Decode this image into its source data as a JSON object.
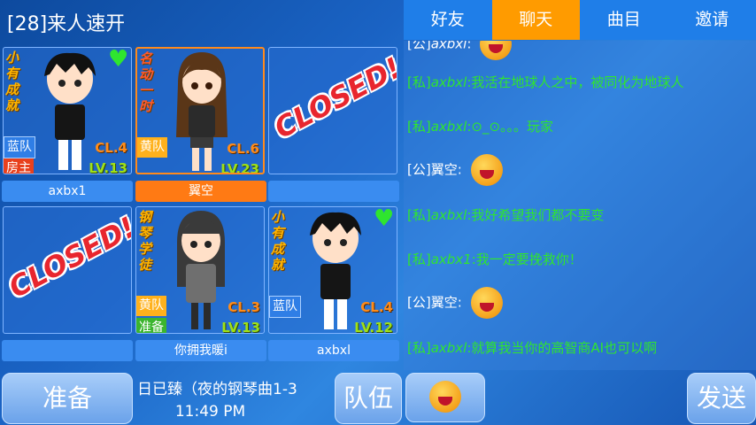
{
  "room": {
    "title": "[28]来人速开"
  },
  "slots": [
    {
      "title": "小有成就",
      "team": "蓝队",
      "role": "房主",
      "cl": "CL.4",
      "lv": "LV.13",
      "name": "axbx1"
    },
    {
      "title": "名动一时",
      "team": "黄队",
      "cl": "CL.6",
      "lv": "LV.23",
      "name": "翼空"
    },
    {
      "closed": "CLOSED!",
      "name": ""
    },
    {
      "closed": "CLOSED!",
      "name": ""
    },
    {
      "title": "钢琴学徒",
      "team": "黄队",
      "role": "准备",
      "cl": "CL.3",
      "lv": "LV.13",
      "name": "你拥我暖i"
    },
    {
      "title": "小有成就",
      "team": "蓝队",
      "cl": "CL.4",
      "lv": "LV.12",
      "name": "axbxl"
    }
  ],
  "bottom": {
    "ready": "准备",
    "song": "日已臻（夜的钢琴曲1-3",
    "time": "11:49 PM",
    "team": "队伍",
    "send": "发送"
  },
  "tabs": [
    "好友",
    "聊天",
    "曲目",
    "邀请"
  ],
  "chat": [
    {
      "prefix": "[公]",
      "user": "axbxl",
      "text": ":",
      "emoji": "crying-face"
    },
    {
      "prefix": "[私]",
      "user": "axbxl",
      "text": ":我活在地球人之中，被同化为地球人"
    },
    {
      "prefix": "[私]",
      "user": "axbxl",
      "text": ":⊙_⊙。。。玩家"
    },
    {
      "prefix": "[公]",
      "user": "翼空",
      "text": ":",
      "emoji": "crying-face"
    },
    {
      "prefix": "[私]",
      "user": "axbxl",
      "text": ":我好希望我们都不要变"
    },
    {
      "prefix": "[私]",
      "user": "axbx1",
      "text": ":我一定要挽救你！"
    },
    {
      "prefix": "[公]",
      "user": "翼空",
      "text": ":",
      "emoji": "crying-face"
    },
    {
      "prefix": "[私]",
      "user": "axbxl",
      "text": ":就算我当你的高智商AI也可以啊"
    }
  ],
  "colors": {
    "accent": "#ff9b00",
    "chat_private": "#2fe52f",
    "heart": "#2fe52f"
  }
}
